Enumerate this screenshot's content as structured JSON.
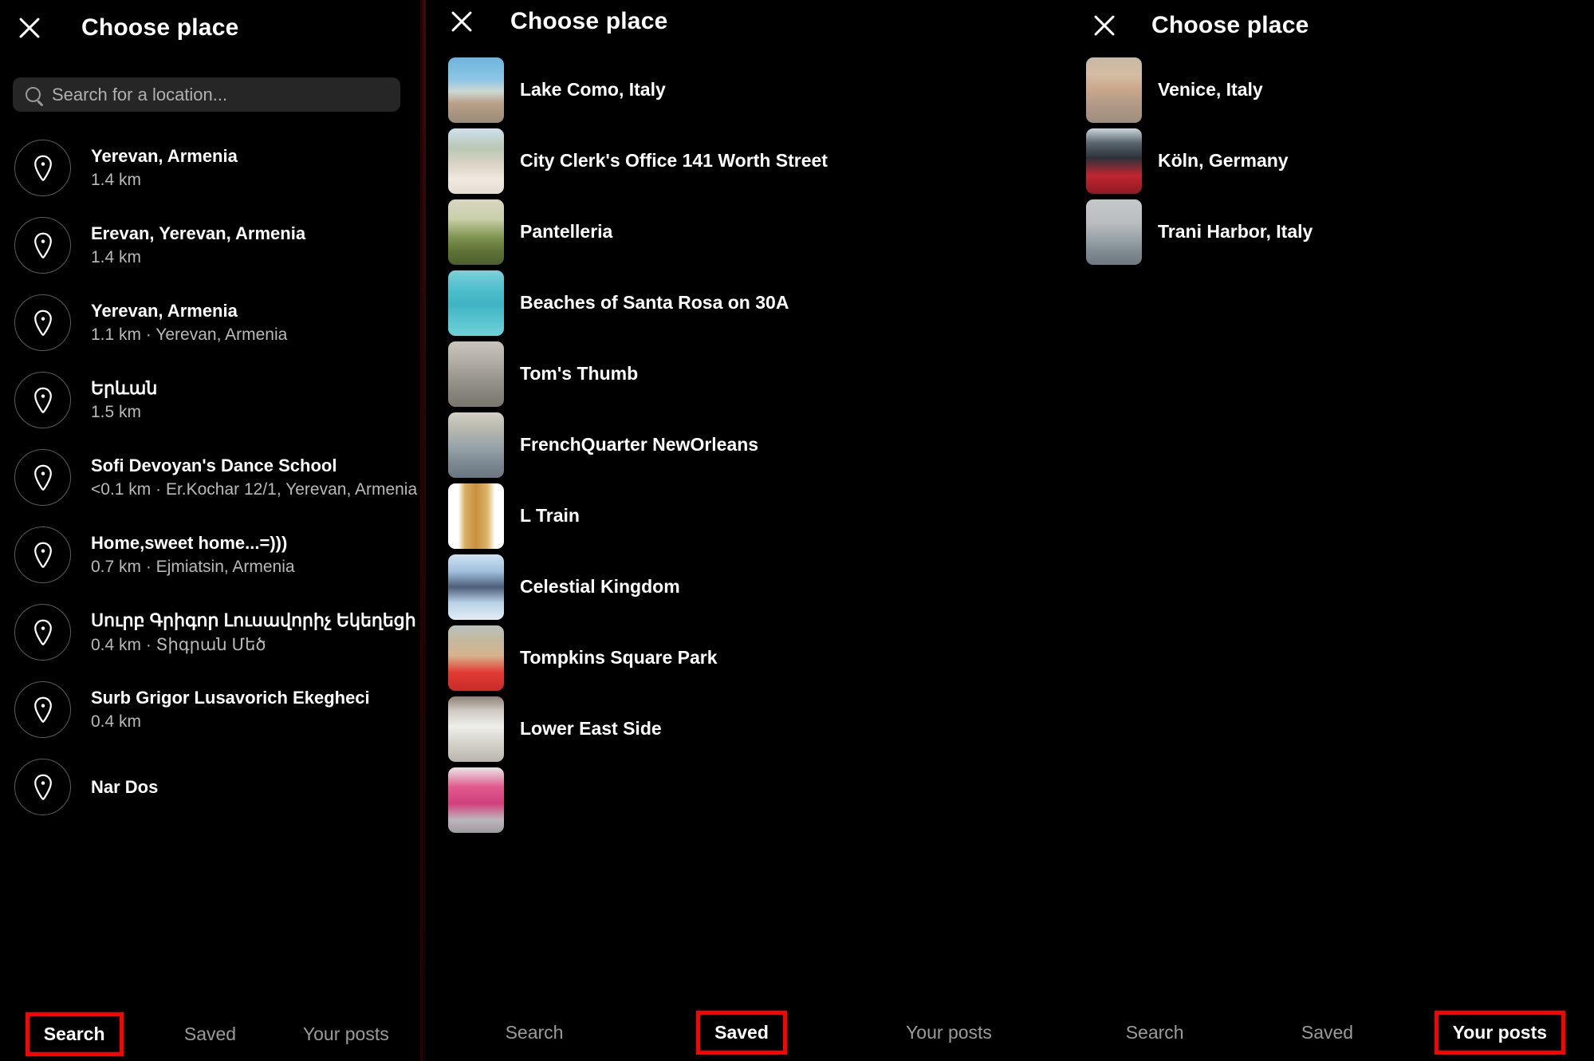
{
  "app": {
    "screen_title": "Choose place",
    "accent_highlight_color": "#ff0000",
    "background_color": "#000000",
    "search_field_color": "#262626"
  },
  "icons": {
    "close": "close-icon",
    "search": "search-icon",
    "pin": "location-pin-icon"
  },
  "panel1": {
    "title": "Choose place",
    "search": {
      "placeholder": "Search for a location...",
      "value": ""
    },
    "results": [
      {
        "name": "Yerevan, Armenia",
        "detail": "1.4 km"
      },
      {
        "name": "Erevan, Yerevan, Armenia",
        "detail": "1.4 km"
      },
      {
        "name": "Yerevan, Armenia",
        "detail": "1.1 km · Yerevan, Armenia"
      },
      {
        "name": "Երևան",
        "detail": "1.5 km"
      },
      {
        "name": "Sofi Devoyan's Dance School",
        "detail": "<0.1 km · Er.Kochar 12/1, Yerevan, Armenia"
      },
      {
        "name": "Home,sweet home...=)))",
        "detail": "0.7 km · Ejmiatsin, Armenia"
      },
      {
        "name": "Սուրբ Գրիգոր Լուսավորիչ Եկեղեցի",
        "detail": "0.4 km · Տիգրան Մեծ"
      },
      {
        "name": "Surb Grigor Lusavorich Ekegheci",
        "detail": "0.4 km"
      },
      {
        "name": "Nar Dos",
        "detail": ""
      }
    ],
    "tabs": [
      {
        "label": "Search",
        "active": true,
        "highlighted": true
      },
      {
        "label": "Saved",
        "active": false,
        "highlighted": false
      },
      {
        "label": "Your posts",
        "active": false,
        "highlighted": false
      }
    ]
  },
  "panel2": {
    "title": "Choose place",
    "results": [
      {
        "name": "Lake Como, Italy",
        "thumb": "woman-sitting-by-lake-railing"
      },
      {
        "name": "City Clerk's Office 141 Worth Street",
        "thumb": "wedding-couple-in-white"
      },
      {
        "name": "Pantelleria",
        "thumb": "cactus-field-landscape"
      },
      {
        "name": "Beaches of Santa Rosa on 30A",
        "thumb": "woman-at-turquoise-beach"
      },
      {
        "name": "Tom's Thumb",
        "thumb": "hiker-on-rocky-trail"
      },
      {
        "name": "FrenchQuarter NewOrleans",
        "thumb": "street-with-buildings"
      },
      {
        "name": "L Train",
        "thumb": "portrait-on-white-background"
      },
      {
        "name": "Celestial Kingdom",
        "thumb": "person-in-snowy-clouds"
      },
      {
        "name": "Tompkins Square Park",
        "thumb": "woman-with-red-object"
      },
      {
        "name": "Lower East Side",
        "thumb": "white-apartment-buildings"
      },
      {
        "name": "",
        "thumb": "pink-flowers"
      }
    ],
    "tabs": [
      {
        "label": "Search",
        "active": false,
        "highlighted": false
      },
      {
        "label": "Saved",
        "active": true,
        "highlighted": true
      },
      {
        "label": "Your posts",
        "active": false,
        "highlighted": false
      }
    ]
  },
  "panel3": {
    "title": "Choose place",
    "results": [
      {
        "name": "Venice, Italy",
        "thumb": "sunset-over-water"
      },
      {
        "name": "Köln, Germany",
        "thumb": "red-train-under-bridge"
      },
      {
        "name": "Trani Harbor, Italy",
        "thumb": "sailboat-on-grey-sea"
      }
    ],
    "tabs": [
      {
        "label": "Search",
        "active": false,
        "highlighted": false
      },
      {
        "label": "Saved",
        "active": false,
        "highlighted": false
      },
      {
        "label": "Your posts",
        "active": true,
        "highlighted": true
      }
    ]
  }
}
